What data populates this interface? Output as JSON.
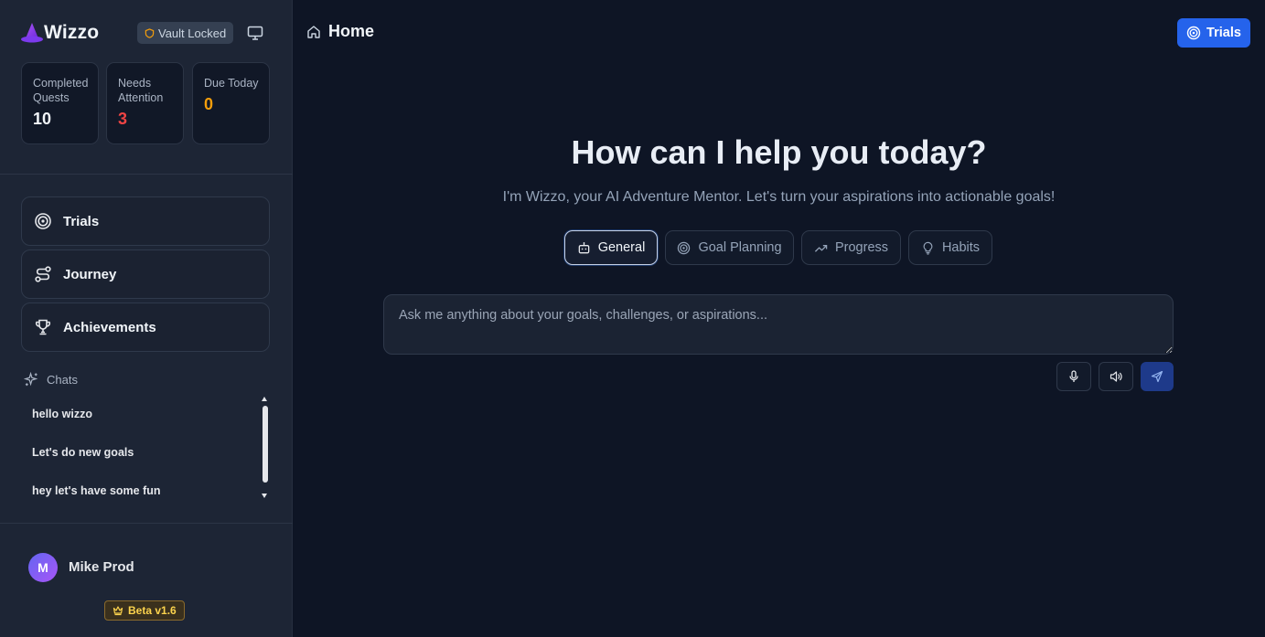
{
  "app": {
    "name": "Wizzo"
  },
  "sidebar": {
    "vault_badge": "Vault Locked",
    "stats": [
      {
        "label": "Completed Quests",
        "value": "10",
        "color": "#f1f5f9"
      },
      {
        "label": "Needs Attention",
        "value": "3",
        "color": "#ef4444"
      },
      {
        "label": "Due Today",
        "value": "0",
        "color": "#f59e0b"
      }
    ],
    "nav": [
      {
        "label": "Trials",
        "icon": "target-icon"
      },
      {
        "label": "Journey",
        "icon": "route-icon"
      },
      {
        "label": "Achievements",
        "icon": "trophy-icon"
      }
    ],
    "chats_label": "Chats",
    "chats": [
      "hello wizzo",
      "Let's do new goals",
      "hey let's have some fun"
    ],
    "user": {
      "initial": "M",
      "name": "Mike Prod"
    },
    "version_badge": "Beta v1.6"
  },
  "header": {
    "title": "Home",
    "trials_button": "Trials"
  },
  "main": {
    "heading": "How can I help you today?",
    "subheading": "I'm Wizzo, your AI Adventure Mentor. Let's turn your aspirations into actionable goals!",
    "modes": [
      {
        "label": "General",
        "icon": "bot-icon",
        "active": true
      },
      {
        "label": "Goal Planning",
        "icon": "target-icon",
        "active": false
      },
      {
        "label": "Progress",
        "icon": "trending-up-icon",
        "active": false
      },
      {
        "label": "Habits",
        "icon": "lightbulb-icon",
        "active": false
      }
    ],
    "input_placeholder": "Ask me anything about your goals, challenges, or aspirations..."
  },
  "colors": {
    "accent": "#2563eb",
    "sidebar_bg": "#1d2535",
    "main_bg": "#0e1525"
  }
}
